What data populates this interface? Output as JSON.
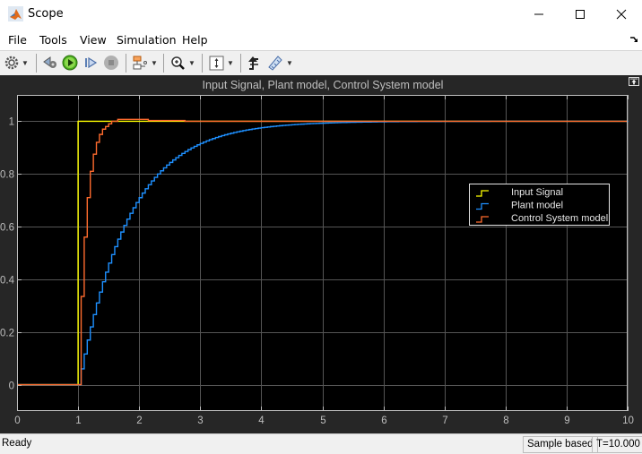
{
  "window": {
    "title": "Scope",
    "controls": [
      "minimize",
      "maximize",
      "close"
    ]
  },
  "menu": {
    "items": [
      "File",
      "Tools",
      "View",
      "Simulation",
      "Help"
    ]
  },
  "toolbar": {
    "icons": [
      "settings-icon",
      "step-back-icon",
      "run-icon",
      "step-forward-icon",
      "stop-icon",
      "signal-selector-icon",
      "zoom-icon",
      "scale-axes-icon",
      "triggers-icon",
      "measurements-icon"
    ]
  },
  "status": {
    "text": "Ready",
    "mode": "Sample based",
    "time": "T=10.000"
  },
  "colors": {
    "input": "#ffff00",
    "plant": "#1e90ff",
    "control": "#ff6b2e",
    "background": "#000000",
    "frame": "#262626",
    "grid": "#555555"
  },
  "chart_data": {
    "type": "line",
    "title": "Input Signal, Plant model, Control System model",
    "xlabel": "",
    "ylabel": "",
    "xlim": [
      0,
      10
    ],
    "ylim": [
      -0.1,
      1.1
    ],
    "xticks": [
      "0",
      "1",
      "2",
      "3",
      "4",
      "5",
      "6",
      "7",
      "8",
      "9",
      "10"
    ],
    "yticks": [
      "0",
      "0.2",
      "0.4",
      "0.6",
      "0.8",
      "1"
    ],
    "ytick_values": [
      0,
      0.2,
      0.4,
      0.6,
      0.8,
      1
    ],
    "grid": true,
    "legend_position": "right-center",
    "step_style": true,
    "series": [
      {
        "name": "Input Signal",
        "color": "#ffff00",
        "x": [
          0,
          1,
          1,
          10
        ],
        "y": [
          0,
          0,
          1,
          1
        ]
      },
      {
        "name": "Plant model",
        "color": "#1e90ff",
        "model": "discrete first-order: y[n] = 1 - 0.94^n, sample time 0.05 s, starting t = 1.05",
        "x": [
          0,
          1.05,
          1.1,
          1.15,
          1.2,
          1.25,
          1.3,
          1.4,
          1.5,
          1.75,
          2.0,
          2.5,
          3.0,
          3.5,
          4.0,
          5.0,
          6.0,
          10.0
        ],
        "y": [
          0,
          0.06,
          0.116,
          0.169,
          0.219,
          0.266,
          0.31,
          0.39,
          0.461,
          0.605,
          0.709,
          0.847,
          0.92,
          0.958,
          0.978,
          0.994,
          0.998,
          1.0
        ]
      },
      {
        "name": "Control System model",
        "color": "#ff6b2e",
        "x": [
          0,
          1.05,
          1.1,
          1.15,
          1.2,
          1.25,
          1.3,
          1.35,
          1.4,
          1.45,
          1.5,
          1.55,
          1.65,
          2.15,
          2.75,
          10
        ],
        "y": [
          0,
          0.335,
          0.56,
          0.71,
          0.81,
          0.875,
          0.92,
          0.95,
          0.97,
          0.98,
          0.99,
          1.0,
          1.007,
          1.003,
          1.0,
          1.0
        ]
      }
    ]
  }
}
